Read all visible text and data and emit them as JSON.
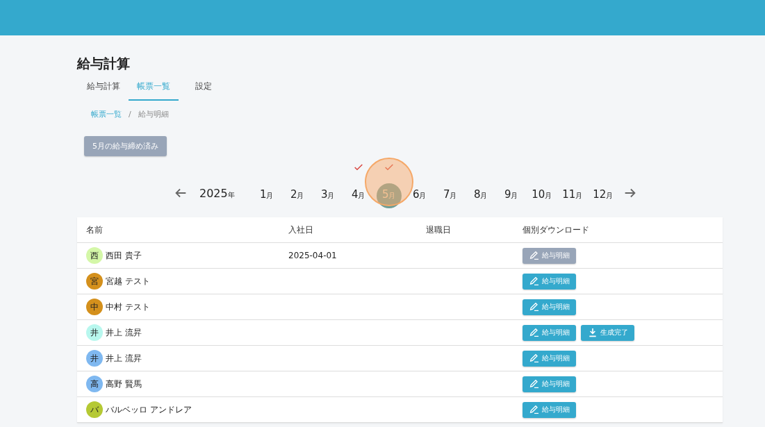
{
  "title": "給与計算",
  "tabs": [
    {
      "label": "給与計算",
      "selected": false
    },
    {
      "label": "帳票一覧",
      "selected": true
    },
    {
      "label": "設定",
      "selected": false
    }
  ],
  "breadcrumb": [
    {
      "label": "帳票一覧",
      "kind": "link"
    },
    {
      "label": "給与明細",
      "kind": "current"
    }
  ],
  "breadcrumb_separator": "/",
  "closed_button": {
    "label": "5月の給与締め済み",
    "disabled": true
  },
  "year": {
    "number": "2025",
    "unit": "年"
  },
  "months": [
    {
      "number": "1",
      "unit": "月",
      "checked": false,
      "selected": false
    },
    {
      "number": "2",
      "unit": "月",
      "checked": false,
      "selected": false
    },
    {
      "number": "3",
      "unit": "月",
      "checked": false,
      "selected": false
    },
    {
      "number": "4",
      "unit": "月",
      "checked": true,
      "selected": false
    },
    {
      "number": "5",
      "unit": "月",
      "checked": true,
      "selected": true
    },
    {
      "number": "6",
      "unit": "月",
      "checked": false,
      "selected": false
    },
    {
      "number": "7",
      "unit": "月",
      "checked": false,
      "selected": false
    },
    {
      "number": "8",
      "unit": "月",
      "checked": false,
      "selected": false
    },
    {
      "number": "9",
      "unit": "月",
      "checked": false,
      "selected": false
    },
    {
      "number": "10",
      "unit": "月",
      "checked": false,
      "selected": false
    },
    {
      "number": "11",
      "unit": "月",
      "checked": false,
      "selected": false
    },
    {
      "number": "12",
      "unit": "月",
      "checked": false,
      "selected": false
    }
  ],
  "table": {
    "columns": [
      "名前",
      "入社日",
      "退職日",
      "個別ダウンロード"
    ],
    "rows": [
      {
        "avatar": "西",
        "color": "#d4f7a8",
        "name": "西田 貴子",
        "hire_date": "2025-04-01",
        "buttons": [
          {
            "label": "給与明細",
            "kind": "edit",
            "disabled": true
          }
        ]
      },
      {
        "avatar": "宮",
        "color": "#d4901c",
        "name": "宮越 テスト",
        "buttons": [
          {
            "label": "給与明細",
            "kind": "edit",
            "disabled": false
          }
        ]
      },
      {
        "avatar": "中",
        "color": "#d4901c",
        "name": "中村 テスト",
        "buttons": [
          {
            "label": "給与明細",
            "kind": "edit",
            "disabled": false
          }
        ]
      },
      {
        "avatar": "井",
        "color": "#b8f7ee",
        "name": "井上 流昇",
        "buttons": [
          {
            "label": "給与明細",
            "kind": "edit",
            "disabled": false
          },
          {
            "label": "生成完了",
            "kind": "download",
            "disabled": false
          }
        ]
      },
      {
        "avatar": "井",
        "color": "#7fb8f0",
        "name": "井上 流昇",
        "buttons": [
          {
            "label": "給与明細",
            "kind": "edit",
            "disabled": false
          }
        ]
      },
      {
        "avatar": "高",
        "color": "#7fb8f0",
        "name": "高野 賢馬",
        "buttons": [
          {
            "label": "給与明細",
            "kind": "edit",
            "disabled": false
          }
        ]
      },
      {
        "avatar": "バ",
        "color": "#b5c934",
        "name": "バルベッロ アンドレア",
        "buttons": [
          {
            "label": "給与明細",
            "kind": "edit",
            "disabled": false
          }
        ]
      }
    ]
  }
}
